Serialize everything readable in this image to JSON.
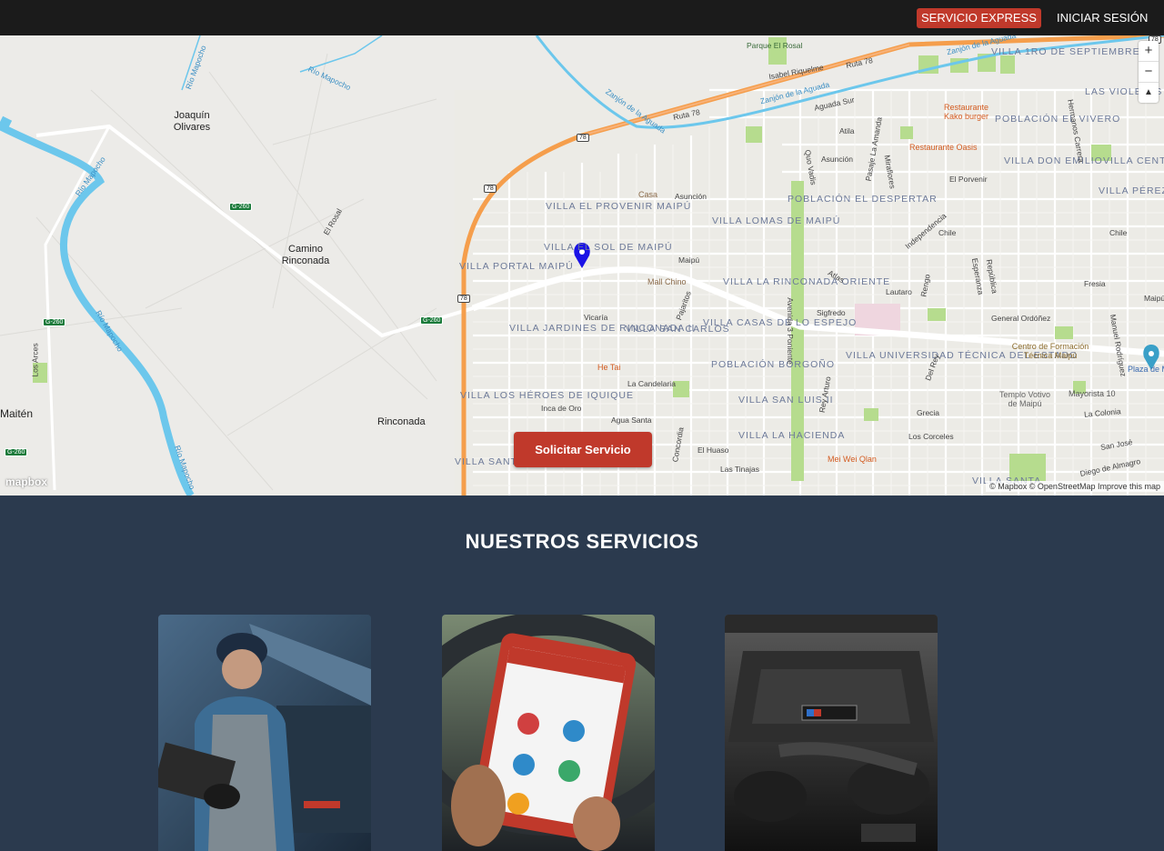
{
  "nav": {
    "express_label": "SERVICIO EXPRESS",
    "login_label": "INICIAR SESIÓN"
  },
  "map": {
    "zoom_in": "+",
    "zoom_out": "−",
    "compass": "▲",
    "request_button": "Solicitar Servicio",
    "logo": "mapbox",
    "attribution": "© Mapbox © OpenStreetMap  Improve this map",
    "labels": {
      "joaquin": "Joaquín Olivares",
      "camino": "Camino Rinconada",
      "rinconada": "Rinconada",
      "maiten": "Maitén",
      "parque": "Parque El Rosal",
      "isabel": "Isabel Riquelme",
      "ruta78": "Ruta 78",
      "rio1": "Río Mapocho",
      "rio2": "Río Mapocho",
      "rio3": "Río Mapocho",
      "zanjon1": "Zanjón de la Aguada",
      "zanjon2": "Zanjón de la Aguada",
      "el_rosal": "El Rosal",
      "los_arces": "Los Arces",
      "villa_provenir": "VILLA EL PROVENIR MAIPÚ",
      "villa_sol": "VILLA EL SOL DE MAIPÚ",
      "villa_portal": "VILLA PORTAL MAIPÚ",
      "villa_jardines": "VILLA JARDINES DE RINCONADA II",
      "villa_sancarlos": "VILLA SAN CARLOS",
      "villa_lomas": "VILLA LOMAS DE MAIPÚ",
      "villa_rinconada": "VILLA LA RINCONADA ORIENTE",
      "villa_casas": "VILLA CASAS DE LO ESPEJO",
      "poblacion_borgono": "POBLACIÓN BORGOÑO",
      "villa_sanluis": "VILLA SAN LUIS II",
      "villa_hacienda": "VILLA LA HACIENDA",
      "villa_heroes": "VILLA LOS HÉROES DE IQUIQUE",
      "villa_santa_teresa": "VILLA SANTA TERESA",
      "villa_universidad": "VILLA UNIVERSIDAD TÉCNICA DEL ESTADO",
      "poblacion_despertar": "POBLACIÓN EL DESPERTAR",
      "villa_1ro": "VILLA 1RO DE SEPTIEMBRE",
      "las_violetas": "LAS VIOLETAS",
      "poblacion_vivero": "POBLACIÓN EL VIVERO",
      "villa_don_emilio": "VILLA DON EMILIO",
      "villa_centenario": "VILLA CENTENARIO",
      "villa_perez": "VILLA PÉREZ CANTO",
      "villa_santa": "VILLA SANTA",
      "restaurant_kako": "Restaurante Kako burger",
      "restaurant_oasis": "Restaurante Oasis",
      "mall_chino": "Mall Chino",
      "he_tai": "He Tai",
      "mei_wei": "Mei Wei Qlan",
      "centro_formacion": "Centro de Formación Técnica Maipú",
      "templo": "Templo Votivo de Maipú",
      "mayorista": "Mayorista 10",
      "plaza": "Plaza de M",
      "casa": "Casa",
      "asuncion": "Asunción",
      "maipu_st": "Maipú",
      "vicaria": "Vicaría",
      "pajaritos": "Pajaritos",
      "la_candelaria": "La Candelaria",
      "inca_de_oro": "Inca de Oro",
      "agua_santa": "Agua Santa",
      "el_huaso": "El Huaso",
      "las_tinajas": "Las Tinajas",
      "concordia": "Concordia",
      "avenida_3p": "Avenida 3 Poniente",
      "siglo": "Sigfredo",
      "atlas": "Atlas",
      "lautaro": "Lautaro",
      "general_ordonez": "General Ordóñez",
      "fresia": "Fresia",
      "chile1": "Chile",
      "chile2": "Chile",
      "el_porvenir": "El Porvenir",
      "grecia": "Grecia",
      "los_corceles": "Los Corceles",
      "la_colonia": "La Colonia",
      "san_jose": "San José",
      "diego_almagro": "Diego de Almagro",
      "aguada_sur": "Aguada Sur",
      "atila": "Atila",
      "asuncion2": "Asunción",
      "rey_arturo": "Rey Arturo",
      "del_rey": "Del Rey",
      "independencia": "Independencia",
      "quo_vadis": "Quo Vadis",
      "pasaje_amanda": "Pasaje La Amanda",
      "miraflores": "Miraflores",
      "hermanos_carrera": "Hermanos Carrera",
      "rengo": "Rengo",
      "republica": "República",
      "esperanza": "Esperanza",
      "manuel_rodriguez": "Manuel Rodríguez",
      "maipu2": "Maipú",
      "g260a": "G-260",
      "g260b": "G-260",
      "g260c": "G-260",
      "g260d": "G-260",
      "r78a": "78",
      "r78b": "78",
      "r78c": "78",
      "r78d": "78"
    }
  },
  "services": {
    "title": "NUESTROS SERVICIOS",
    "cards": [
      {
        "name": "mechanic",
        "icon": "mechanic-photo"
      },
      {
        "name": "diagnostics",
        "icon": "tablet-diagnostic-photo"
      },
      {
        "name": "engine",
        "icon": "engine-photo"
      }
    ]
  },
  "colors": {
    "header_bg": "#1b1b1b",
    "accent": "#c0392b",
    "section_bg": "#2b3a4e",
    "river": "#6cc7ec",
    "highway": "#f59e4c",
    "park": "#a8d77a"
  }
}
